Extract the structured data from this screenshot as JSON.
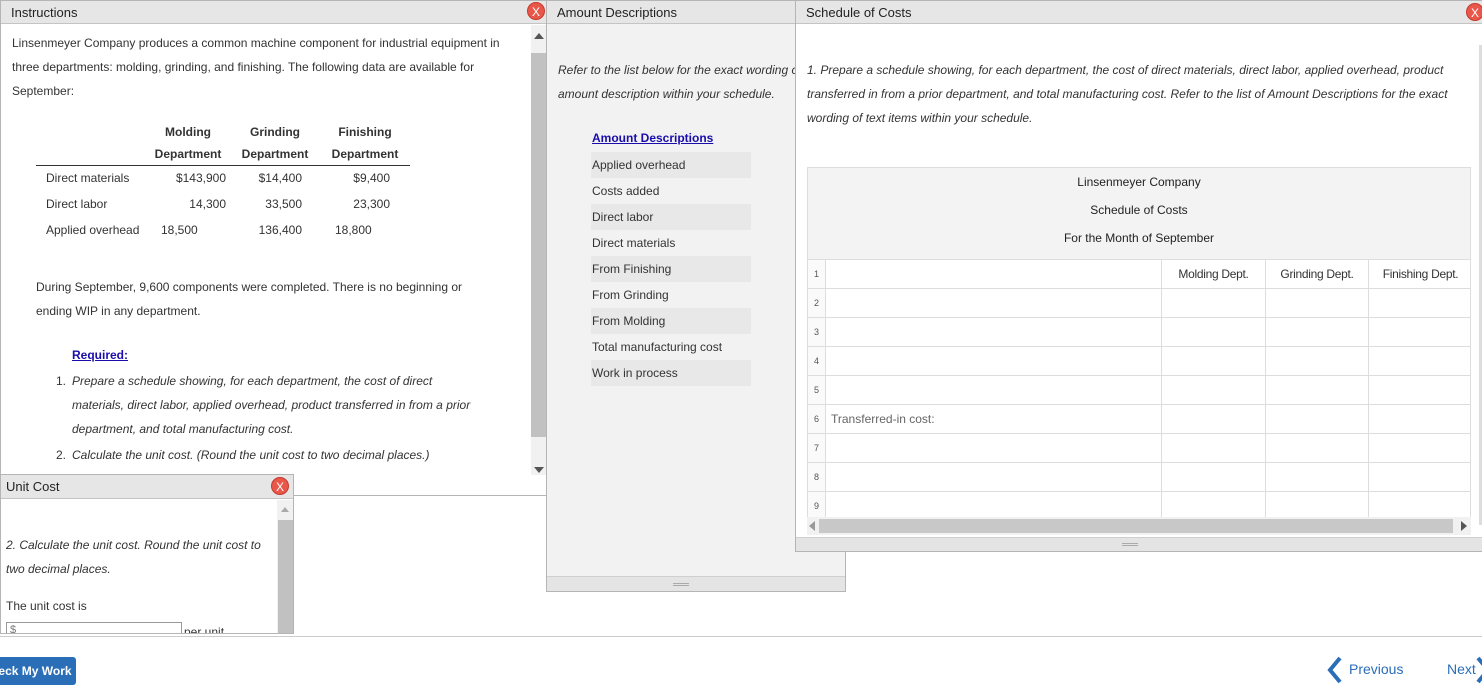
{
  "instructions": {
    "title": "Instructions",
    "close": "X",
    "intro_line1": "Linsenmeyer Company produces a common machine component for industrial equipment in",
    "intro_line2": "three departments: molding, grinding, and finishing. The following data are available for",
    "intro_line3": "September:",
    "table": {
      "col1_top": "Molding",
      "col1_bottom": "Department",
      "col2_top": "Grinding",
      "col2_bottom": "Department",
      "col3_top": "Finishing",
      "col3_bottom": "Department",
      "rows": [
        {
          "label": "Direct materials",
          "molding": "$143,900",
          "grinding": "$14,400",
          "finishing": "$9,400"
        },
        {
          "label": "Direct labor",
          "molding": "14,300",
          "grinding": "33,500",
          "finishing": "23,300"
        },
        {
          "label": "Applied overhead",
          "molding": "18,500",
          "grinding": "136,400",
          "finishing": "18,800"
        }
      ]
    },
    "during_line1": "During September, 9,600 components were completed. There is no beginning or",
    "during_line2": "ending WIP in any department.",
    "required_label": "Required:",
    "req1_num": "1.",
    "req1_line1": "Prepare a schedule showing, for each department, the cost of direct",
    "req1_line2": "materials, direct labor, applied overhead, product transferred in from a prior",
    "req1_line3": "department, and total manufacturing cost.",
    "req2_num": "2.",
    "req2_line1": "Calculate the unit cost. (Round the unit cost to two decimal places.)"
  },
  "amount_descriptions": {
    "title": "Amount Descriptions",
    "refer_line1": "Refer to the list below for the exact wording o",
    "refer_line2": "amount description within your schedule.",
    "heading": "Amount Descriptions",
    "items": [
      "Applied overhead",
      "Costs added",
      "Direct labor",
      "Direct materials",
      "From Finishing",
      "From Grinding",
      "From Molding",
      "Total manufacturing cost",
      "Work in process"
    ]
  },
  "schedule": {
    "title": "Schedule of Costs",
    "instr_line1": "1. Prepare a schedule showing, for each department, the cost of direct materials, direct labor, applied overhead, product",
    "instr_line2": "transferred in from a prior department, and total manufacturing cost. Refer to the list of Amount Descriptions for the exact",
    "instr_line3": "wording of text items within your schedule.",
    "company": "Linsenmeyer Company",
    "report": "Schedule of Costs",
    "period": "For the Month of September",
    "col_molding": "Molding Dept.",
    "col_grinding": "Grinding Dept.",
    "col_finishing": "Finishing Dept.",
    "rows": [
      {
        "num": "1",
        "label": ""
      },
      {
        "num": "2",
        "label": ""
      },
      {
        "num": "3",
        "label": ""
      },
      {
        "num": "4",
        "label": ""
      },
      {
        "num": "5",
        "label": ""
      },
      {
        "num": "6",
        "label": "Transferred-in cost:"
      },
      {
        "num": "7",
        "label": ""
      },
      {
        "num": "8",
        "label": ""
      },
      {
        "num": "9",
        "label": ""
      }
    ]
  },
  "unit_cost": {
    "title": "Unit Cost",
    "close": "X",
    "prompt_line1": "2. Calculate the unit cost. Round the unit cost to",
    "prompt_line2": "two decimal places.",
    "label": "The unit cost is",
    "input_prefix": "$",
    "suffix": "per unit"
  },
  "footer": {
    "check_label": "eck My Work",
    "previous_label": "Previous",
    "next_label": "Next"
  },
  "colors": {
    "link": "#1a0dab",
    "button": "#2a6eb8",
    "close": "#e8574a"
  }
}
